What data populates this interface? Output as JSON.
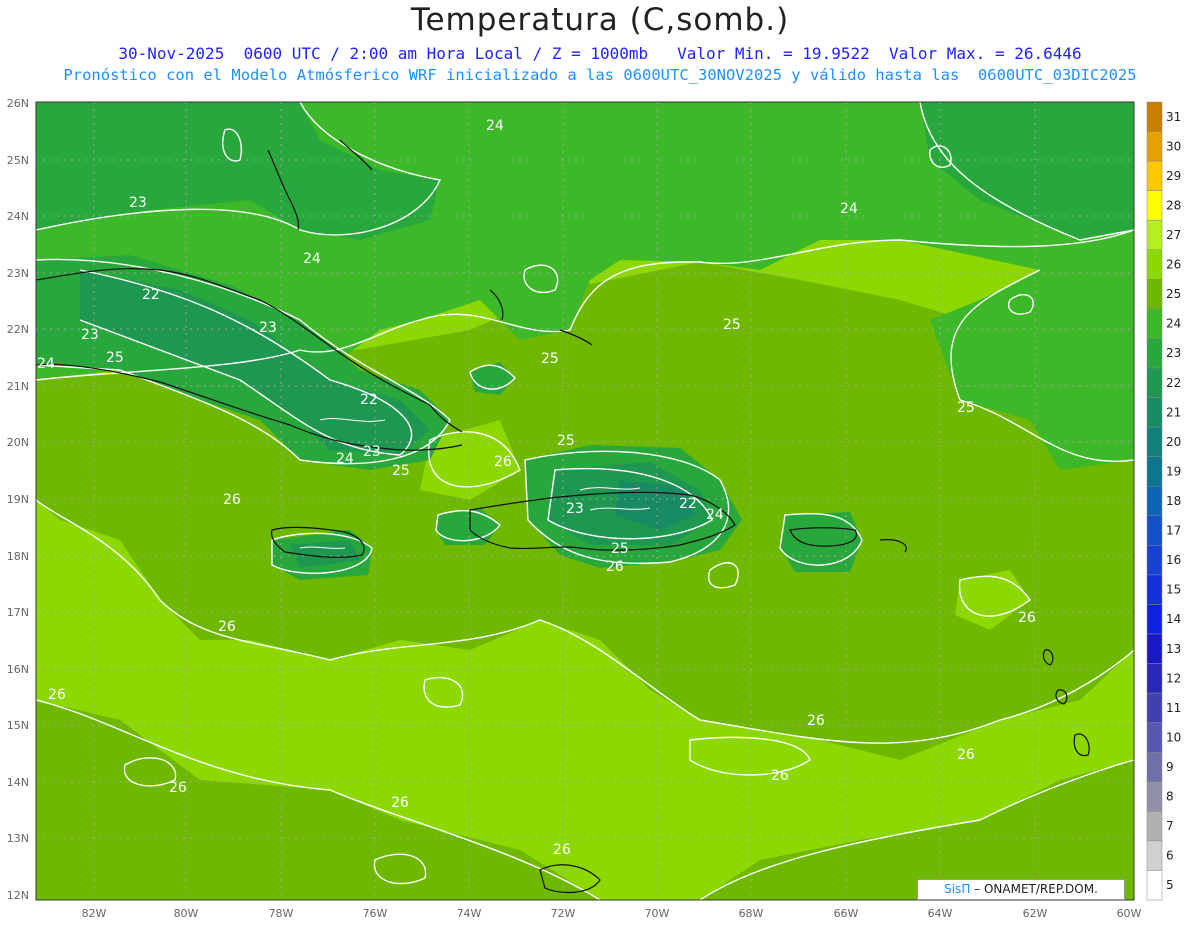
{
  "title": "Temperatura (C,somb.)",
  "subtitle_line1": "30-Nov-2025  0600 UTC / 2:00 am Hora Local / Z = 1000mb   Valor Min. = 19.9522  Valor Max. = 26.6446",
  "subtitle_line2": "Pronóstico con el Modelo Atmósferico WRF inicializado a las 0600UTC_30NOV2025 y válido hasta las  0600UTC_03DIC2025",
  "credit_sis": "SisΠ",
  "credit_rest": "– ONAMET/REP.DOM.",
  "lat_labels": [
    "26N",
    "25N",
    "24N",
    "23N",
    "22N",
    "21N",
    "20N",
    "19N",
    "18N",
    "17N",
    "16N",
    "15N",
    "14N",
    "13N",
    "12N"
  ],
  "lon_labels": [
    "82W",
    "80W",
    "78W",
    "76W",
    "74W",
    "72W",
    "70W",
    "68W",
    "66W",
    "64W",
    "62W",
    "60W"
  ],
  "colorbar": {
    "levels": [
      "31",
      "30",
      "29",
      "28",
      "27",
      "26",
      "25",
      "24",
      "23",
      "22",
      "21",
      "20",
      "19",
      "18",
      "17",
      "16",
      "15",
      "14",
      "13",
      "12",
      "11",
      "10",
      "9",
      "8",
      "7",
      "6",
      "5"
    ],
    "colors": [
      "#c87f00",
      "#e6a000",
      "#ffc800",
      "#ffff00",
      "#b4f020",
      "#8cd800",
      "#6eb800",
      "#3cb828",
      "#28a83c",
      "#1e9850",
      "#188a64",
      "#12807a",
      "#0c7690",
      "#1064b4",
      "#1450c8",
      "#1840d4",
      "#1430dc",
      "#1020e0",
      "#1818c8",
      "#2828b8",
      "#4040b0",
      "#5858b0",
      "#7070a8",
      "#9090a8",
      "#b0b0b0",
      "#d0d0d0",
      "#ffffff"
    ]
  },
  "contour_labels": [
    {
      "text": "24"
    },
    {
      "text": "23"
    },
    {
      "text": "24"
    },
    {
      "text": "24"
    },
    {
      "text": "22"
    },
    {
      "text": "23"
    },
    {
      "text": "23"
    },
    {
      "text": "24"
    },
    {
      "text": "25"
    },
    {
      "text": "25"
    },
    {
      "text": "25"
    },
    {
      "text": "25"
    },
    {
      "text": "22"
    },
    {
      "text": "24"
    },
    {
      "text": "23"
    },
    {
      "text": "25"
    },
    {
      "text": "25"
    },
    {
      "text": "26"
    },
    {
      "text": "26"
    },
    {
      "text": "23"
    },
    {
      "text": "22"
    },
    {
      "text": "24"
    },
    {
      "text": "25"
    },
    {
      "text": "26"
    },
    {
      "text": "26"
    },
    {
      "text": "26"
    },
    {
      "text": "26"
    },
    {
      "text": "26"
    },
    {
      "text": "26"
    },
    {
      "text": "26"
    },
    {
      "text": "26"
    },
    {
      "text": "26"
    },
    {
      "text": "26"
    }
  ]
}
